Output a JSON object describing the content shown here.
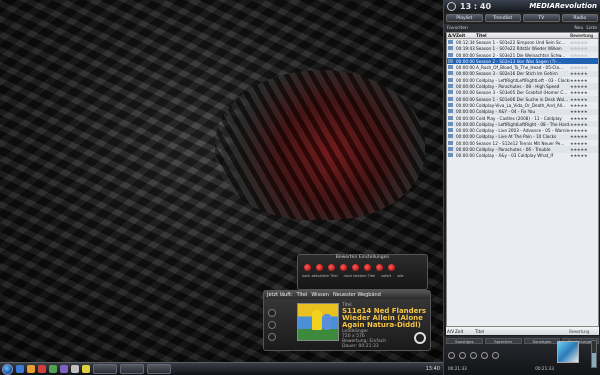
{
  "panel": {
    "clock": "13 : 40",
    "brand": "MEDIARevolution",
    "tabs": [
      "Playlist",
      "Trendlist",
      "TV",
      "Radio"
    ],
    "toolbar": {
      "left": "Favoriten",
      "right1": "Neu",
      "right2": "Liste"
    },
    "list_headers": {
      "av": "A/V",
      "time": "Zeit",
      "title": "Titel",
      "rating": "Bewertung"
    },
    "rows": [
      {
        "av": "",
        "time": "00:12:34",
        "title": "Season 1 - S01e22 Simpson Und Sein Sc...",
        "rating": "☆☆☆☆☆",
        "selected": false
      },
      {
        "av": "",
        "time": "00:19:43",
        "title": "Season 1 - S07e22 Ritstär Wieder Wilken",
        "rating": "☆☆☆☆☆",
        "selected": false
      },
      {
        "av": "",
        "time": "00:00:00",
        "title": "Season 2 - S03e21 Die Weinachtsn Schw...",
        "rating": "☆☆☆☆☆",
        "selected": false
      },
      {
        "av": "",
        "time": "00:00:00",
        "title": "Season 2 - S02e13 Von Was Sagen (?)-...",
        "rating": "☆☆☆☆☆",
        "selected": true
      },
      {
        "av": "",
        "time": "00:00:00",
        "title": "A_Rush_Of_Blood_To_The_Head - 05-Cla...",
        "rating": "☆☆☆☆☆",
        "selected": false
      },
      {
        "av": "",
        "time": "00:00:00",
        "title": "Season 3 - S02e16 Der Stich Im Gehirn",
        "rating": "★★★★★",
        "selected": false
      },
      {
        "av": "",
        "time": "00:00:00",
        "title": "Coldplay - LeftRightLeftRightLeft - 03 - Clocks",
        "rating": "★★★★★",
        "selected": false
      },
      {
        "av": "",
        "time": "00:00:00",
        "title": "Coldplay - Parachutes - 08 - High Speed",
        "rating": "★★★★★",
        "selected": false
      },
      {
        "av": "",
        "time": "00:00:00",
        "title": "Season 3 - S03e05 Der Grabfall (Homer C...",
        "rating": "★★★★★",
        "selected": false
      },
      {
        "av": "",
        "time": "00:00:00",
        "title": "Season 1 - S01e06 Der Suche in Desk Wal...",
        "rating": "★★★★★",
        "selected": false
      },
      {
        "av": "",
        "time": "00:00:00",
        "title": "Coldplay-Viva_La_Vida_Or_Death_And_All...",
        "rating": "★★★★★",
        "selected": false
      },
      {
        "av": "",
        "time": "00:00:00",
        "title": "Coldplay - X&Y - 04 - Fix You",
        "rating": "★★★★★",
        "selected": false
      },
      {
        "av": "",
        "time": "00:00:00",
        "title": "Cold Play - Castles (2008) - 11 - Coldplay",
        "rating": "★★★★★",
        "selected": false
      },
      {
        "av": "",
        "time": "00:00:00",
        "title": "Coldplay - LeftRightLeftRight - 08 - The Hard...",
        "rating": "★★★★★",
        "selected": false
      },
      {
        "av": "",
        "time": "00:00:00",
        "title": "Coldplay - Live 2003 - Advance - 05 - Warning",
        "rating": "★★★★★",
        "selected": false
      },
      {
        "av": "",
        "time": "00:00:00",
        "title": "Coldplay - Live At The Pain - 10 Clocks",
        "rating": "★★★★★",
        "selected": false
      },
      {
        "av": "",
        "time": "00:00:00",
        "title": "Season 12 - S12e12 Tennis Mit Neuer Pe...",
        "rating": "★★★★★",
        "selected": false
      },
      {
        "av": "",
        "time": "00:00:00",
        "title": "Coldplay - Parachutes - 06 - Trouble",
        "rating": "★★★★★",
        "selected": false
      },
      {
        "av": "",
        "time": "00:00:00",
        "title": "Coldplay - X&y - 03 Coldplay What_If",
        "rating": "★★★★★",
        "selected": false
      }
    ],
    "footer": {
      "av": "A/V",
      "time": "Zeit",
      "title": "Titel",
      "rating": "Bewertung"
    },
    "bottom_buttons": [
      "Sonstiges",
      "Sprechen",
      "Sonstiges",
      "Einstellungen"
    ],
    "time_left": "00:21:33",
    "time_right": "00:21:33",
    "volume_level": 0.55
  },
  "player": {
    "header": [
      "Jetzt läuft:",
      "Titel",
      "Wissen",
      "Neuester Wegbänd"
    ],
    "label": "Titel",
    "title": "S11e14 Ned Flanders Wieder Allein (Alone Again Natura-Diddl)",
    "info1": "Leadsänger",
    "info2": "720 x 576",
    "info3": "Bewertung: Einfach",
    "info4": "Dauer: 00:21:33"
  },
  "rating_box": {
    "title": "Bewerten Einstellungen",
    "labels": [
      "nach aktuellem Titel",
      "nach letztem Titel",
      "sofort",
      "alle"
    ]
  },
  "taskbar": {
    "clock": "13:40"
  }
}
